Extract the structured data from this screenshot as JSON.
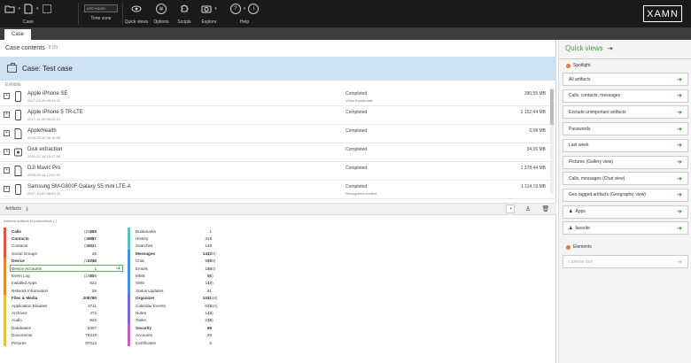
{
  "toolbar": {
    "case_label": "Case",
    "timezone_value": "UTC+01:00",
    "timezone_label": "Time zone",
    "quickviews_label": "Quick views",
    "options_label": "Options",
    "scripts_label": "Scripts",
    "explore_label": "Explore",
    "help_label": "Help",
    "brand": "XAMN"
  },
  "tabs": {
    "case": "Case"
  },
  "main": {
    "title": "Case contents",
    "title_count": "8 (0)",
    "case_name": "Case: Test case",
    "exhibits_label": "Exhibits"
  },
  "exhibits": [
    {
      "name": "Apple iPhone SE",
      "date": "2017-04-20 09:44:22",
      "status": "Completed",
      "status2": "Video thumbnails",
      "size": "390,55 MB",
      "icon": "phone-icon"
    },
    {
      "name": "Apple iPhone 5 TR-LTE",
      "date": "2017-11-30 08:23:10",
      "status": "Completed",
      "status2": "",
      "size": "1 152,44 MB",
      "icon": "phone-icon"
    },
    {
      "name": "AppleHealth",
      "date": "2018-05-30 08:16:08",
      "status": "Completed",
      "status2": "",
      "size": "0,08 MB",
      "icon": "document-icon"
    },
    {
      "name": "Disk extraction",
      "date": "2016-07-18 15:17:00",
      "status": "Completed",
      "status2": "",
      "size": "34,06 MB",
      "icon": "disk-icon"
    },
    {
      "name": "DJI Mavic Pro",
      "date": "2018-08-14 12:07:21",
      "status": "Completed",
      "status2": "",
      "size": "1 378,44 MB",
      "icon": "document-icon"
    },
    {
      "name": "Samsung SM-G800F Galaxy S5 mini LTE-A",
      "date": "2017-10-03 08:59:32",
      "status": "Completed",
      "status2": "Recognized content",
      "size": "1 114,19 MB",
      "icon": "phone-icon"
    }
  ],
  "artifacts": {
    "label": "Artifacts",
    "deleted_note": "Deleted artifacts in parenthesis ( )"
  },
  "categories_left": [
    {
      "label": "Calls",
      "count": "385",
      "deleted": "(26)",
      "head": true,
      "color": "#d9534f"
    },
    {
      "label": "Contacts",
      "count": "2067",
      "deleted": "(582)",
      "head": true,
      "color": "#d9534f"
    },
    {
      "label": "Contacts",
      "count": "2041",
      "deleted": "(582)",
      "head": false,
      "color": "#d9534f"
    },
    {
      "label": "Social Groups",
      "count": "26",
      "deleted": "",
      "head": false,
      "color": "#d9534f"
    },
    {
      "label": "Device",
      "count": "1748",
      "deleted": "(162)",
      "head": true,
      "color": "#e08a3a"
    },
    {
      "label": "Device Accounts",
      "count": "1",
      "deleted": "",
      "head": false,
      "color": "#e08a3a",
      "selected": true
    },
    {
      "label": "Event Log",
      "count": "856",
      "deleted": "(162)",
      "head": false,
      "color": "#e08a3a"
    },
    {
      "label": "Installed Apps",
      "count": "822",
      "deleted": "",
      "head": false,
      "color": "#e08a3a"
    },
    {
      "label": "Network Information",
      "count": "28",
      "deleted": "",
      "head": false,
      "color": "#e08a3a"
    },
    {
      "label": "Files & Media",
      "count": "208780",
      "deleted": "",
      "head": true,
      "color": "#e0c040"
    },
    {
      "label": "Application Binaries",
      "count": "4711",
      "deleted": "",
      "head": false,
      "color": "#e0c040"
    },
    {
      "label": "Archives",
      "count": "472",
      "deleted": "",
      "head": false,
      "color": "#e0c040"
    },
    {
      "label": "Audio",
      "count": "925",
      "deleted": "",
      "head": false,
      "color": "#e0c040"
    },
    {
      "label": "Databases",
      "count": "5307",
      "deleted": "",
      "head": false,
      "color": "#e0c040"
    },
    {
      "label": "Documents",
      "count": "75319",
      "deleted": "",
      "head": false,
      "color": "#e0c040"
    },
    {
      "label": "Pictures",
      "count": "97013",
      "deleted": "",
      "head": false,
      "color": "#e0c040"
    }
  ],
  "categories_right": [
    {
      "label": "Bookmarks",
      "count": "1",
      "deleted": "",
      "head": false,
      "color": "#5bc0c0"
    },
    {
      "label": "History",
      "count": "318",
      "deleted": "",
      "head": false,
      "color": "#5bc0c0"
    },
    {
      "label": "Searches",
      "count": "149",
      "deleted": "",
      "head": false,
      "color": "#5bc0c0"
    },
    {
      "label": "Messages",
      "count": "1412",
      "deleted": "(24)",
      "head": true,
      "color": "#4a90d9"
    },
    {
      "label": "Chat",
      "count": "988",
      "deleted": "(19)",
      "head": false,
      "color": "#4a90d9"
    },
    {
      "label": "Emails",
      "count": "193",
      "deleted": "(54)",
      "head": false,
      "color": "#4a90d9"
    },
    {
      "label": "MMS",
      "count": "55",
      "deleted": "(1)",
      "head": false,
      "color": "#4a90d9"
    },
    {
      "label": "SMS",
      "count": "117",
      "deleted": "(3)",
      "head": false,
      "color": "#4a90d9"
    },
    {
      "label": "Status Updates",
      "count": "61",
      "deleted": "",
      "head": false,
      "color": "#4a90d9"
    },
    {
      "label": "Organizer",
      "count": "1031",
      "deleted": "(118)",
      "head": true,
      "color": "#7b68c8"
    },
    {
      "label": "Calendar Events",
      "count": "674",
      "deleted": "(110)",
      "head": false,
      "color": "#7b68c8"
    },
    {
      "label": "Notes",
      "count": "143",
      "deleted": "(1)",
      "head": false,
      "color": "#7b68c8"
    },
    {
      "label": "Tasks",
      "count": "214",
      "deleted": "(5)",
      "head": false,
      "color": "#7b68c8"
    },
    {
      "label": "Security",
      "count": "69",
      "deleted": "",
      "head": true,
      "color": "#c060c0"
    },
    {
      "label": "Accounts",
      "count": "29",
      "deleted": "",
      "head": false,
      "color": "#c060c0"
    },
    {
      "label": "Certificates",
      "count": "6",
      "deleted": "",
      "head": false,
      "color": "#c060c0"
    }
  ],
  "quickviews": {
    "title": "Quick views",
    "spotlight_label": "Spotlight",
    "items": [
      {
        "label": "All artifacts",
        "star": false
      },
      {
        "label": "Calls, contacts, messages",
        "star": false
      },
      {
        "label": "Exclude unimportant artifacts",
        "star": false
      },
      {
        "label": "Passwords",
        "star": false
      },
      {
        "label": "Last week",
        "star": false
      },
      {
        "label": "Pictures (Gallery view)",
        "star": false
      },
      {
        "label": "Calls, messages (Chat view)",
        "star": false
      },
      {
        "label": "Geo tagged artifacts (Geographic view)",
        "star": false
      },
      {
        "label": "Apps",
        "star": true
      },
      {
        "label": "favorite",
        "star": true
      }
    ],
    "elements_label": "Elements",
    "elements_placeholder": "Lipense fast",
    "accent": "#2a9a2a"
  }
}
